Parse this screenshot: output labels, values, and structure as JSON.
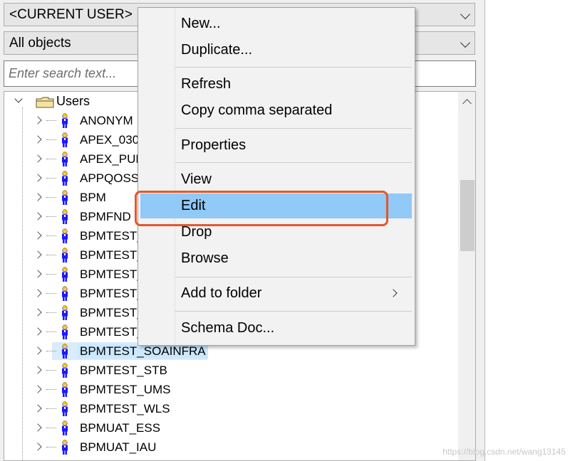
{
  "header": {
    "schema_select": "<CURRENT USER>",
    "object_filter": "All objects",
    "search_placeholder": "Enter search text..."
  },
  "tree": {
    "root_label": "Users",
    "items": [
      "ANONYM",
      "APEX_030",
      "APEX_PUE",
      "APPQOSS",
      "BPM",
      "BPMFND",
      "BPMTEST_",
      "BPMTEST_",
      "BPMTEST_",
      "BPMTEST_",
      "BPMTEST_",
      "BPMTEST_",
      "BPMTEST_SOAINFRA",
      "BPMTEST_STB",
      "BPMTEST_UMS",
      "BPMTEST_WLS",
      "BPMUAT_ESS",
      "BPMUAT_IAU"
    ],
    "selected_index": 12
  },
  "context_menu": {
    "new": "New...",
    "duplicate": "Duplicate...",
    "refresh": "Refresh",
    "copy_comma": "Copy comma separated",
    "properties": "Properties",
    "view": "View",
    "edit": "Edit",
    "drop": "Drop",
    "browse": "Browse",
    "add_to_folder": "Add to folder",
    "schema_doc": "Schema Doc..."
  },
  "watermark": "https://blog.csdn.net/wang13145",
  "colors": {
    "menu_hover": "#91c9f7",
    "highlight_box": "#e2572d",
    "selection": "#cce8ff",
    "user_icon": "#1a1aff"
  }
}
